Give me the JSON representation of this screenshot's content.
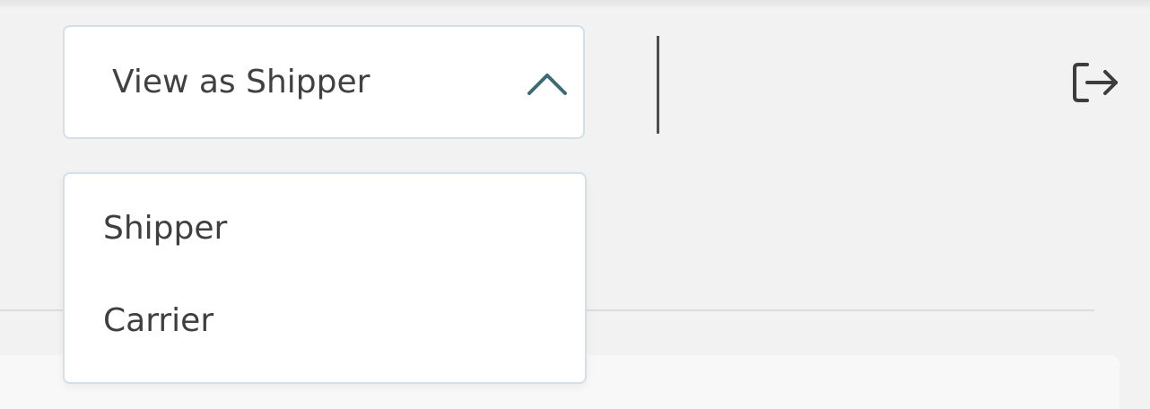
{
  "header": {
    "view_select": {
      "label": "View as Shipper",
      "expanded": true,
      "chevron_icon": "chevron-up-icon"
    },
    "logout_icon": "logout-icon"
  },
  "dropdown": {
    "options": [
      {
        "label": "Shipper"
      },
      {
        "label": "Carrier"
      }
    ]
  },
  "colors": {
    "background": "#f2f2f2",
    "select_border": "#d3dfe9",
    "text": "#414141",
    "chevron": "#3e6b73"
  }
}
